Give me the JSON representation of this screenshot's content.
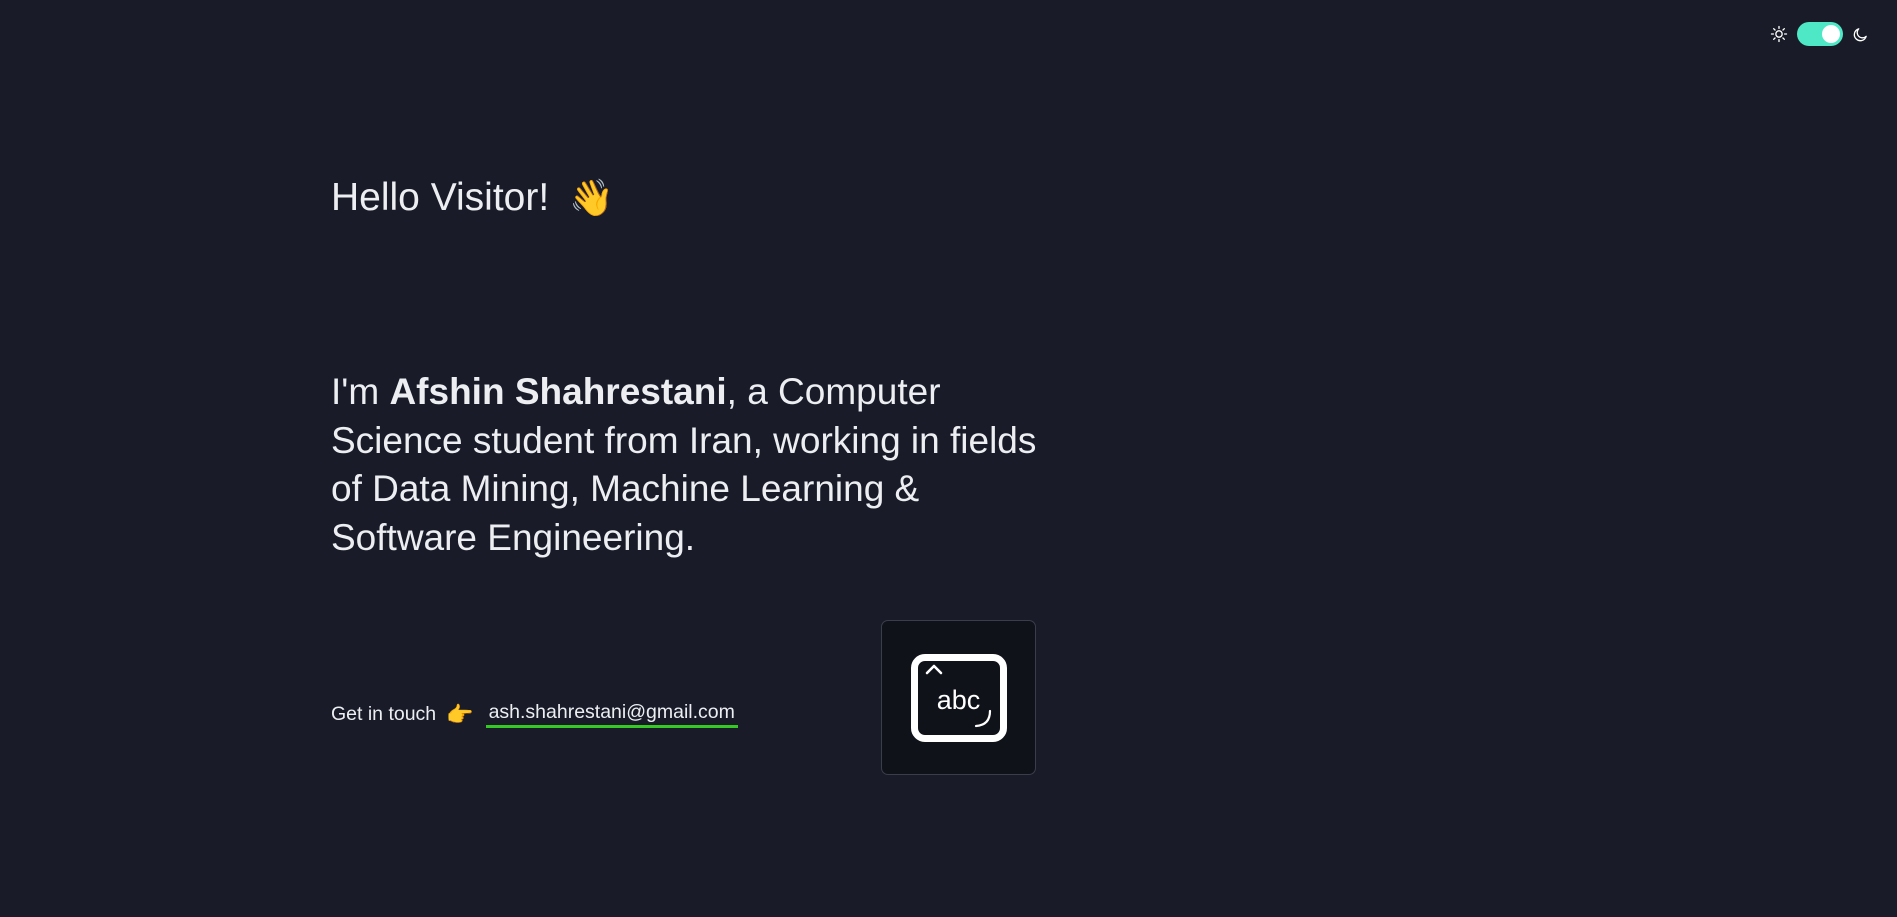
{
  "theme_toggle": {
    "light_icon": "sun-icon",
    "dark_icon": "moon-icon",
    "enabled": true,
    "accent_color": "#4ee8c6"
  },
  "greeting": {
    "text": "Hello Visitor!",
    "emoji": "👋"
  },
  "intro": {
    "prefix": "I'm ",
    "name": "Afshin Shahrestani",
    "suffix": ", a Computer Science student from Iran, working in fields of Data Mining, Machine Learning & Software Engineering."
  },
  "contact": {
    "label": "Get in touch",
    "emoji": "👉",
    "email": "ash.shahrestani@gmail.com",
    "underline_color": "#34c924"
  },
  "keyboard_badge": {
    "icon": "keyboard-abc-icon",
    "text": "abc"
  },
  "colors": {
    "background": "#191c28",
    "text": "#eceef2"
  }
}
